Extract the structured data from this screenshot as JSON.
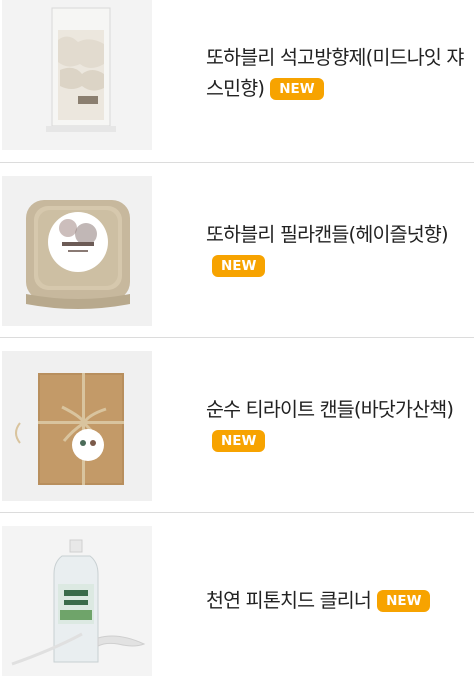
{
  "products": [
    {
      "title": "또하블리 석고방향제(미드나잇 쟈스민향)",
      "badge": "NEW",
      "image": "plaster-diffuser-photo"
    },
    {
      "title": "또하블리 필라캔들(헤이즐넛향)",
      "badge": "NEW",
      "image": "pillar-candle-photo"
    },
    {
      "title": "순수 티라이트 캔들(바닷가산책)",
      "badge": "NEW",
      "image": "tealight-candle-photo"
    },
    {
      "title": "천연 피톤치드 클리너",
      "badge": "NEW",
      "image": "phytoncide-cleaner-photo"
    }
  ],
  "colors": {
    "badge": "#f7a300",
    "divider": "#dcdcdc",
    "text": "#222222"
  }
}
